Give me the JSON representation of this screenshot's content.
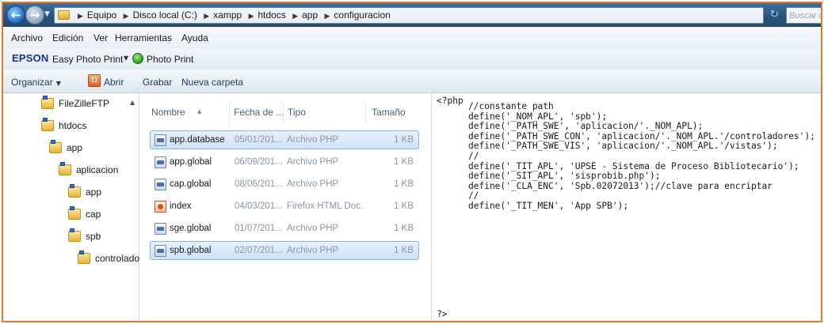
{
  "address_bar": {
    "breadcrumbs": [
      "Equipo",
      "Disco local (C:)",
      "xampp",
      "htdocs",
      "app",
      "configuracion"
    ],
    "search_placeholder": "Buscar co"
  },
  "menu": [
    "Archivo",
    "Edición",
    "Ver",
    "Herramientas",
    "Ayuda"
  ],
  "epson_bar": {
    "logo": "EPSON",
    "easy_photo_print": "Easy Photo Print",
    "photo_print": "Photo Print"
  },
  "command_bar": {
    "organize": "Organizar",
    "open": "Abrir",
    "burn": "Grabar",
    "new_folder": "Nueva carpeta"
  },
  "nav_tree": [
    {
      "label": "FileZilleFTP"
    },
    {
      "label": "htdocs"
    },
    {
      "label": "app"
    },
    {
      "label": "aplicacion"
    },
    {
      "label": "app"
    },
    {
      "label": "cap"
    },
    {
      "label": "spb"
    },
    {
      "label": "controlador"
    }
  ],
  "file_list": {
    "columns": [
      "Nombre",
      "Fecha de ...",
      "Tipo",
      "Tamaño"
    ],
    "rows": [
      {
        "name": "app.database",
        "date": "05/01/201...",
        "type": "Archivo PHP",
        "size": "1 KB",
        "selected": true,
        "icon": "php-file-icon"
      },
      {
        "name": "app.global",
        "date": "06/09/201...",
        "type": "Archivo PHP",
        "size": "1 KB",
        "selected": false,
        "icon": "php-file-icon"
      },
      {
        "name": "cap.global",
        "date": "08/06/201...",
        "type": "Archivo PHP",
        "size": "1 KB",
        "selected": false,
        "icon": "php-file-icon"
      },
      {
        "name": "index",
        "date": "04/03/201...",
        "type": "Firefox HTML Doc...",
        "size": "1 KB",
        "selected": false,
        "icon": "html-file-icon"
      },
      {
        "name": "sge.global",
        "date": "01/07/201...",
        "type": "Archivo PHP",
        "size": "1 KB",
        "selected": false,
        "icon": "php-file-icon"
      },
      {
        "name": "spb.global",
        "date": "02/07/201...",
        "type": "Archivo PHP",
        "size": "1 KB",
        "selected": true,
        "icon": "php-file-icon"
      }
    ]
  },
  "code": {
    "open_tag": "<?php",
    "lines": [
      "//constante path",
      "define('_NOM_APL', 'spb');",
      "define('_PATH_SWE', 'aplicacion/'._NOM_APL);",
      "define('_PATH_SWE_CON', 'aplicacion/'._NOM_APL.'/controladores');",
      "define('_PATH_SWE_VIS', 'aplicacion/'._NOM_APL.'/vistas');",
      "//",
      "define('_TIT_APL', 'UPSE - Sistema de Proceso Bibliotecario');",
      "define('_SIT_APL', 'sisprobib.php');",
      "define('_CLA_ENC', 'Spb.02072013');//clave para encriptar",
      "//",
      "define('_TIT_MEN', 'App SPB');"
    ],
    "close_tag": "?>"
  },
  "colors": {
    "frame_border": "#e07b2c",
    "address_bar": "#2a5278",
    "selection": "#cfe3f9"
  }
}
